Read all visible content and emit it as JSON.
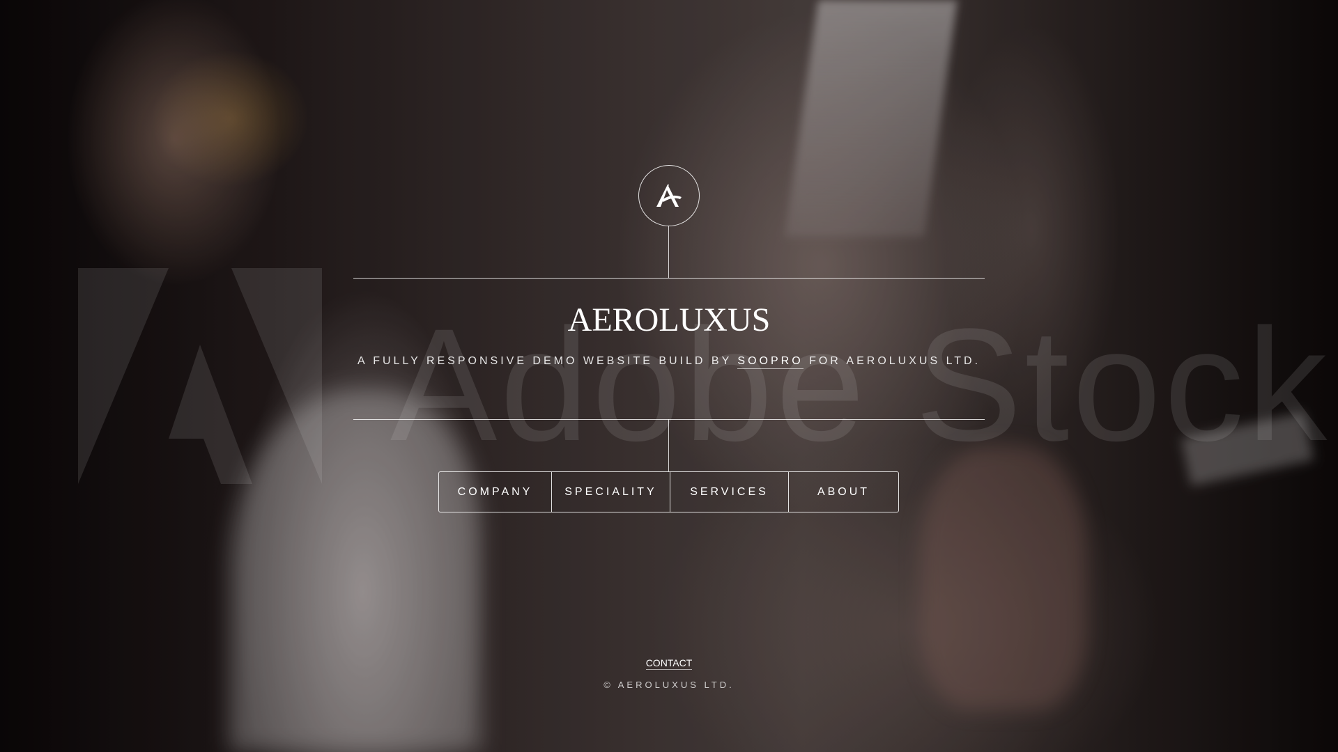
{
  "brand": {
    "name": "AEROLUXUS",
    "logo_icon": "aeroluxus-monogram-icon"
  },
  "tagline": {
    "before": "A FULLY RESPONSIVE DEMO WEBSITE BUILD BY ",
    "link": "SOOPRO",
    "after": " FOR AEROLUXUS LTD."
  },
  "nav": {
    "items": [
      {
        "label": "COMPANY"
      },
      {
        "label": "SPECIALITY"
      },
      {
        "label": "SERVICES"
      },
      {
        "label": "ABOUT"
      }
    ]
  },
  "footer": {
    "contact_label": "CONTACT",
    "copyright": "© AEROLUXUS LTD."
  },
  "watermark": {
    "text": "Adobe Stock"
  },
  "colors": {
    "foreground": "#ffffff",
    "background": "#0c0809"
  }
}
